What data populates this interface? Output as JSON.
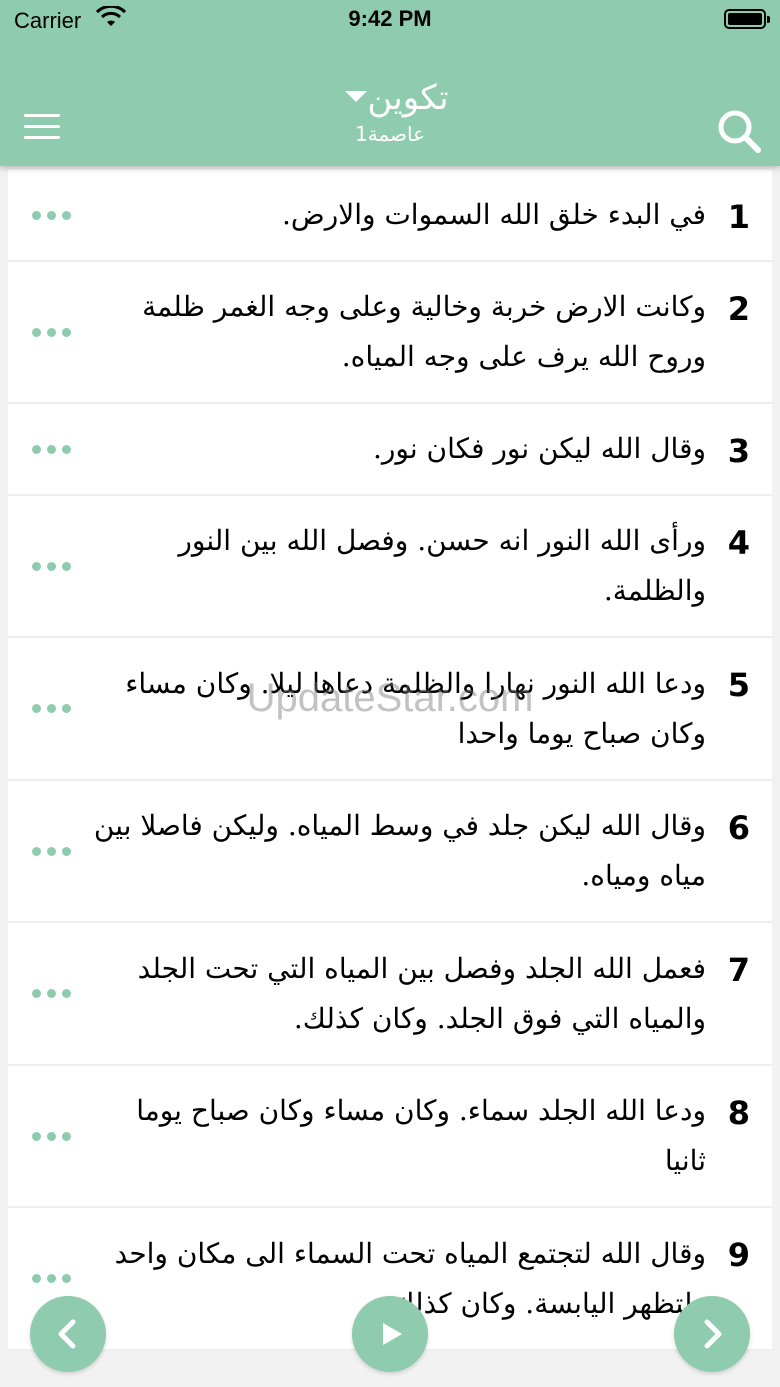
{
  "status_bar": {
    "carrier": "Carrier",
    "time": "9:42 PM"
  },
  "header": {
    "book": "تكوين",
    "chapter": "عاصمة1"
  },
  "verses": [
    {
      "num": "1",
      "text": "في البدء خلق الله السموات والارض."
    },
    {
      "num": "2",
      "text": "وكانت الارض خربة وخالية وعلى وجه الغمر ظلمة وروح الله يرف على وجه المياه."
    },
    {
      "num": "3",
      "text": "وقال الله ليكن نور فكان نور."
    },
    {
      "num": "4",
      "text": "ورأى الله النور انه حسن. وفصل الله بين النور والظلمة."
    },
    {
      "num": "5",
      "text": "ودعا الله النور نهارا والظلمة دعاها ليلا. وكان مساء وكان صباح يوما واحدا"
    },
    {
      "num": "6",
      "text": "وقال الله ليكن جلد في وسط المياه. وليكن فاصلا بين مياه ومياه."
    },
    {
      "num": "7",
      "text": "فعمل الله الجلد وفصل بين المياه التي تحت الجلد والمياه التي فوق الجلد. وكان كذلك."
    },
    {
      "num": "8",
      "text": "ودعا الله الجلد سماء. وكان مساء وكان صباح يوما ثانيا"
    },
    {
      "num": "9",
      "text": "وقال الله لتجتمع المياه تحت السماء الى مكان واحد ولتظهر اليابسة. وكان كذلك."
    }
  ],
  "watermark": "UpdateStar.com",
  "icons": {
    "menu": "hamburger-icon",
    "search": "search-icon",
    "more": "ellipsis-icon",
    "prev": "chevron-left-icon",
    "play": "play-icon",
    "next": "chevron-right-icon"
  },
  "colors": {
    "accent": "#8fcbae",
    "background": "#f2f2f2"
  }
}
